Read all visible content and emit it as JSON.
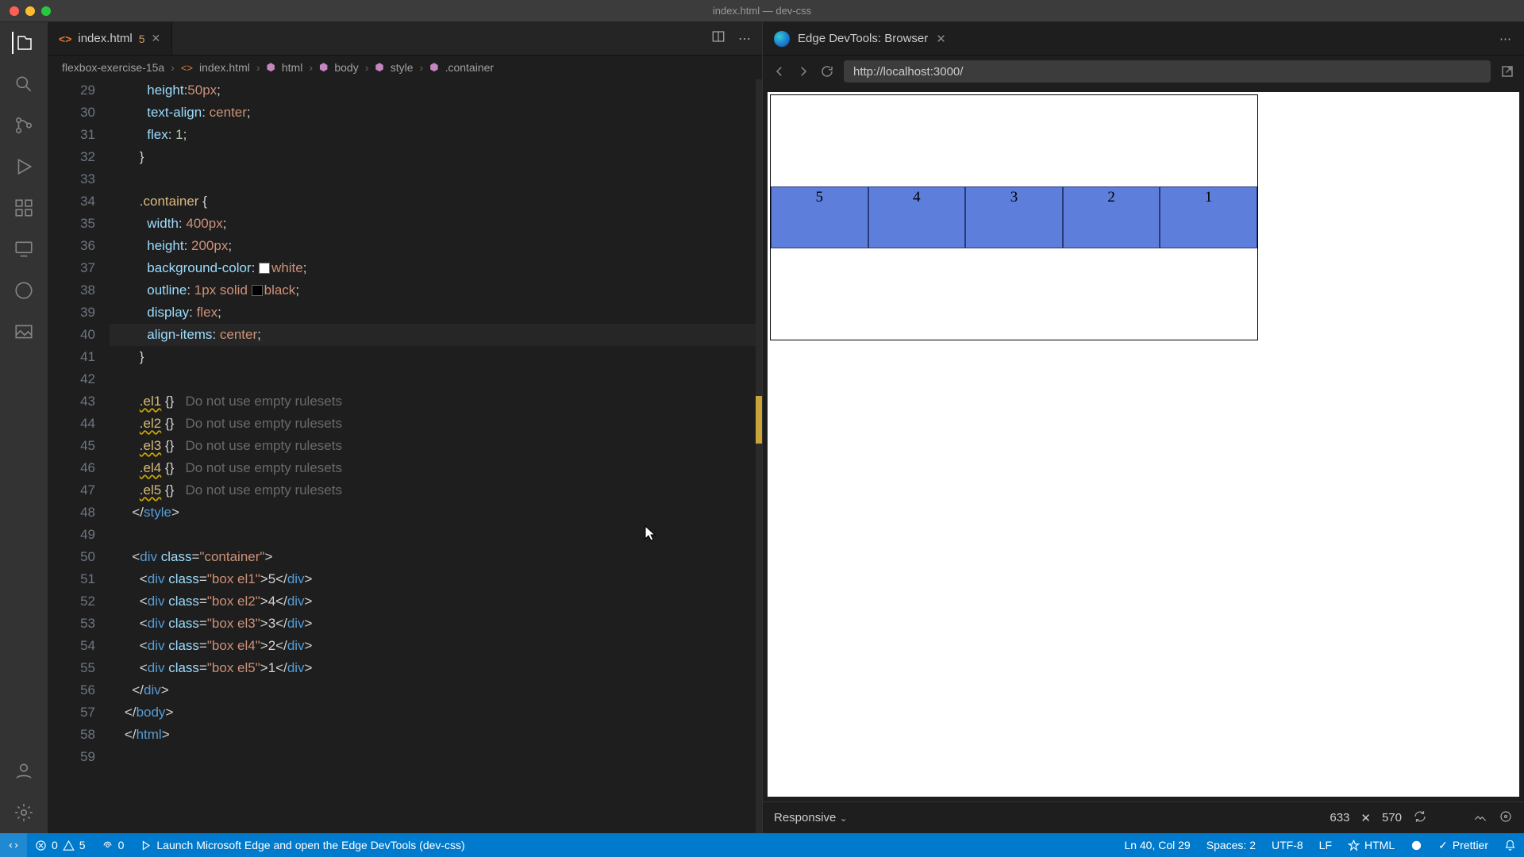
{
  "window": {
    "title": "index.html — dev-css"
  },
  "tab": {
    "icon": "<>",
    "name": "index.html",
    "mod": "5"
  },
  "breadcrumb": {
    "items": [
      "flexbox-exercise-15a",
      "index.html",
      "html",
      "body",
      "style",
      ".container"
    ]
  },
  "code": {
    "startLine": 29,
    "lines": [
      {
        "n": 29,
        "ind": 3,
        "raw": "height:50px;",
        "t": [
          [
            "prop",
            "height"
          ],
          [
            "punc",
            ":"
          ],
          [
            "val",
            "50px"
          ],
          [
            "punc",
            ";"
          ]
        ]
      },
      {
        "n": 30,
        "ind": 3,
        "raw": "text-align: center;",
        "t": [
          [
            "prop",
            "text-align"
          ],
          [
            "punc",
            ": "
          ],
          [
            "val",
            "center"
          ],
          [
            "punc",
            ";"
          ]
        ]
      },
      {
        "n": 31,
        "ind": 3,
        "raw": "flex: 1;",
        "t": [
          [
            "prop",
            "flex"
          ],
          [
            "punc",
            ": "
          ],
          [
            "num",
            "1"
          ],
          [
            "punc",
            ";"
          ]
        ]
      },
      {
        "n": 32,
        "ind": 2,
        "raw": "}",
        "t": [
          [
            "punc",
            "}"
          ]
        ]
      },
      {
        "n": 33,
        "ind": 0,
        "raw": "",
        "t": []
      },
      {
        "n": 34,
        "ind": 2,
        "raw": ".container {",
        "t": [
          [
            "sel",
            ".container"
          ],
          [
            "punc",
            " {"
          ]
        ]
      },
      {
        "n": 35,
        "ind": 3,
        "raw": "width: 400px;",
        "t": [
          [
            "prop",
            "width"
          ],
          [
            "punc",
            ": "
          ],
          [
            "val",
            "400px"
          ],
          [
            "punc",
            ";"
          ]
        ]
      },
      {
        "n": 36,
        "ind": 3,
        "raw": "height: 200px;",
        "t": [
          [
            "prop",
            "height"
          ],
          [
            "punc",
            ": "
          ],
          [
            "val",
            "200px"
          ],
          [
            "punc",
            ";"
          ]
        ]
      },
      {
        "n": 37,
        "ind": 3,
        "raw": "background-color: white;",
        "t": [
          [
            "prop",
            "background-color"
          ],
          [
            "punc",
            ": "
          ],
          [
            "swatch",
            "#fff"
          ],
          [
            "val",
            "white"
          ],
          [
            "punc",
            ";"
          ]
        ]
      },
      {
        "n": 38,
        "ind": 3,
        "raw": "outline: 1px solid black;",
        "t": [
          [
            "prop",
            "outline"
          ],
          [
            "punc",
            ": "
          ],
          [
            "val",
            "1px solid "
          ],
          [
            "swatch",
            "#000"
          ],
          [
            "val",
            "black"
          ],
          [
            "punc",
            ";"
          ]
        ]
      },
      {
        "n": 39,
        "ind": 3,
        "raw": "display: flex;",
        "t": [
          [
            "prop",
            "display"
          ],
          [
            "punc",
            ": "
          ],
          [
            "val",
            "flex"
          ],
          [
            "punc",
            ";"
          ]
        ]
      },
      {
        "n": 40,
        "ind": 3,
        "raw": "align-items: center;",
        "hl": true,
        "t": [
          [
            "prop",
            "align-items"
          ],
          [
            "punc",
            ": "
          ],
          [
            "val",
            "center"
          ],
          [
            "punc",
            ";"
          ]
        ]
      },
      {
        "n": 41,
        "ind": 2,
        "raw": "}",
        "t": [
          [
            "punc",
            "}"
          ]
        ]
      },
      {
        "n": 42,
        "ind": 0,
        "raw": "",
        "t": []
      },
      {
        "n": 43,
        "ind": 2,
        "raw": ".el1 {}   Do not use empty rulesets",
        "t": [
          [
            "selw",
            ".el1"
          ],
          [
            "punc",
            " {}"
          ],
          [
            "hint",
            "   Do not use empty rulesets"
          ]
        ]
      },
      {
        "n": 44,
        "ind": 2,
        "raw": ".el2 {}   Do not use empty rulesets",
        "t": [
          [
            "selw",
            ".el2"
          ],
          [
            "punc",
            " {}"
          ],
          [
            "hint",
            "   Do not use empty rulesets"
          ]
        ]
      },
      {
        "n": 45,
        "ind": 2,
        "raw": ".el3 {}   Do not use empty rulesets",
        "t": [
          [
            "selw",
            ".el3"
          ],
          [
            "punc",
            " {}"
          ],
          [
            "hint",
            "   Do not use empty rulesets"
          ]
        ]
      },
      {
        "n": 46,
        "ind": 2,
        "raw": ".el4 {}   Do not use empty rulesets",
        "t": [
          [
            "selw",
            ".el4"
          ],
          [
            "punc",
            " {}"
          ],
          [
            "hint",
            "   Do not use empty rulesets"
          ]
        ]
      },
      {
        "n": 47,
        "ind": 2,
        "raw": ".el5 {}   Do not use empty rulesets",
        "t": [
          [
            "selw",
            ".el5"
          ],
          [
            "punc",
            " {}"
          ],
          [
            "hint",
            "   Do not use empty rulesets"
          ]
        ]
      },
      {
        "n": 48,
        "ind": 1,
        "raw": "</style>",
        "t": [
          [
            "punc",
            "</"
          ],
          [
            "tag",
            "style"
          ],
          [
            "punc",
            ">"
          ]
        ]
      },
      {
        "n": 49,
        "ind": 0,
        "raw": "",
        "t": []
      },
      {
        "n": 50,
        "ind": 1,
        "raw": "<div class=\"container\">",
        "t": [
          [
            "punc",
            "<"
          ],
          [
            "tag",
            "div"
          ],
          [
            "punc",
            " "
          ],
          [
            "attr",
            "class"
          ],
          [
            "punc",
            "="
          ],
          [
            "str",
            "\"container\""
          ],
          [
            "punc",
            ">"
          ]
        ]
      },
      {
        "n": 51,
        "ind": 2,
        "raw": "<div class=\"box el1\">5</div>",
        "t": [
          [
            "punc",
            "<"
          ],
          [
            "tag",
            "div"
          ],
          [
            "punc",
            " "
          ],
          [
            "attr",
            "class"
          ],
          [
            "punc",
            "="
          ],
          [
            "str",
            "\"box el1\""
          ],
          [
            "punc",
            ">"
          ],
          [
            "punc",
            "5</"
          ],
          [
            "tag",
            "div"
          ],
          [
            "punc",
            ">"
          ]
        ]
      },
      {
        "n": 52,
        "ind": 2,
        "raw": "<div class=\"box el2\">4</div>",
        "t": [
          [
            "punc",
            "<"
          ],
          [
            "tag",
            "div"
          ],
          [
            "punc",
            " "
          ],
          [
            "attr",
            "class"
          ],
          [
            "punc",
            "="
          ],
          [
            "str",
            "\"box el2\""
          ],
          [
            "punc",
            ">"
          ],
          [
            "punc",
            "4</"
          ],
          [
            "tag",
            "div"
          ],
          [
            "punc",
            ">"
          ]
        ]
      },
      {
        "n": 53,
        "ind": 2,
        "raw": "<div class=\"box el3\">3</div>",
        "t": [
          [
            "punc",
            "<"
          ],
          [
            "tag",
            "div"
          ],
          [
            "punc",
            " "
          ],
          [
            "attr",
            "class"
          ],
          [
            "punc",
            "="
          ],
          [
            "str",
            "\"box el3\""
          ],
          [
            "punc",
            ">"
          ],
          [
            "punc",
            "3</"
          ],
          [
            "tag",
            "div"
          ],
          [
            "punc",
            ">"
          ]
        ]
      },
      {
        "n": 54,
        "ind": 2,
        "raw": "<div class=\"box el4\">2</div>",
        "t": [
          [
            "punc",
            "<"
          ],
          [
            "tag",
            "div"
          ],
          [
            "punc",
            " "
          ],
          [
            "attr",
            "class"
          ],
          [
            "punc",
            "="
          ],
          [
            "str",
            "\"box el4\""
          ],
          [
            "punc",
            ">"
          ],
          [
            "punc",
            "2</"
          ],
          [
            "tag",
            "div"
          ],
          [
            "punc",
            ">"
          ]
        ]
      },
      {
        "n": 55,
        "ind": 2,
        "raw": "<div class=\"box el5\">1</div>",
        "t": [
          [
            "punc",
            "<"
          ],
          [
            "tag",
            "div"
          ],
          [
            "punc",
            " "
          ],
          [
            "attr",
            "class"
          ],
          [
            "punc",
            "="
          ],
          [
            "str",
            "\"box el5\""
          ],
          [
            "punc",
            ">"
          ],
          [
            "punc",
            "1</"
          ],
          [
            "tag",
            "div"
          ],
          [
            "punc",
            ">"
          ]
        ]
      },
      {
        "n": 56,
        "ind": 1,
        "raw": "</div>",
        "t": [
          [
            "punc",
            "</"
          ],
          [
            "tag",
            "div"
          ],
          [
            "punc",
            ">"
          ]
        ]
      },
      {
        "n": 57,
        "ind": 0,
        "raw": "</body>",
        "t": [
          [
            "punc",
            "</"
          ],
          [
            "tag",
            "body"
          ],
          [
            "punc",
            ">"
          ]
        ]
      },
      {
        "n": 58,
        "ind": 0,
        "raw": "</html>",
        "t": [
          [
            "punc",
            "</"
          ],
          [
            "tag",
            "html"
          ],
          [
            "punc",
            ">"
          ]
        ]
      },
      {
        "n": 59,
        "ind": 0,
        "raw": "",
        "t": []
      }
    ]
  },
  "devtools": {
    "title": "Edge DevTools: Browser",
    "url": "http://localhost:3000/",
    "responsive": "Responsive",
    "vw": "633",
    "times": "✕",
    "vh": "570"
  },
  "preview": {
    "boxes": [
      "5",
      "4",
      "3",
      "2",
      "1"
    ]
  },
  "status": {
    "errors": "0",
    "warnings": "5",
    "ports": "0",
    "launch": "Launch Microsoft Edge and open the Edge DevTools (dev-css)",
    "lncol": "Ln 40, Col 29",
    "spaces": "Spaces: 2",
    "encoding": "UTF-8",
    "eol": "LF",
    "lang": "HTML",
    "prettier": "Prettier"
  }
}
